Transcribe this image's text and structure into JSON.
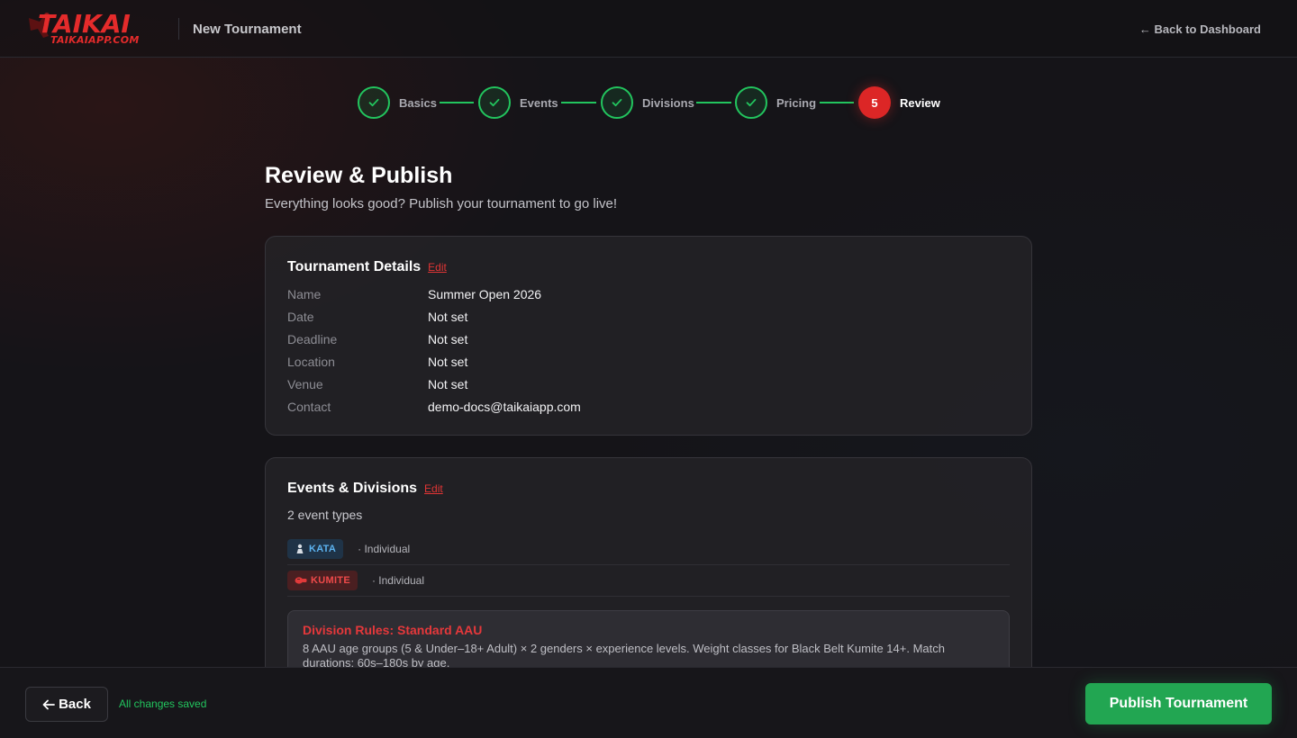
{
  "brand": {
    "name": "TAIKAI",
    "domain": "TAIKAIAPP.COM",
    "accent_color": "#dc2626"
  },
  "header": {
    "title": "New Tournament",
    "back_link": "← Back to Dashboard"
  },
  "stepper": {
    "steps": [
      {
        "label": "Basics",
        "status": "complete"
      },
      {
        "label": "Events",
        "status": "complete"
      },
      {
        "label": "Divisions",
        "status": "complete"
      },
      {
        "label": "Pricing",
        "status": "complete"
      },
      {
        "label": "Review",
        "status": "active",
        "number": "5"
      }
    ],
    "complete_color": "#22c55e"
  },
  "main": {
    "title": "Review & Publish",
    "subtitle": "Everything looks good? Publish your tournament to go live!"
  },
  "tournament_details": {
    "title": "Tournament Details",
    "edit_label": "Edit",
    "rows": [
      {
        "label": "Name",
        "value": "Summer Open 2026"
      },
      {
        "label": "Date",
        "value": "Not set"
      },
      {
        "label": "Deadline",
        "value": "Not set"
      },
      {
        "label": "Location",
        "value": "Not set"
      },
      {
        "label": "Venue",
        "value": "Not set"
      },
      {
        "label": "Contact",
        "value": "demo-docs@taikaiapp.com"
      }
    ]
  },
  "events_divisions": {
    "title": "Events & Divisions",
    "edit_label": "Edit",
    "count": "2 event types",
    "events": [
      {
        "name": "KATA",
        "meta": "· Individual",
        "icon": "kata-figure-icon",
        "color": "#5cb3f0"
      },
      {
        "name": "KUMITE",
        "meta": "· Individual",
        "icon": "kumite-glove-icon",
        "color": "#ef4a4a"
      }
    ],
    "rules": {
      "title": "Division Rules: Standard AAU",
      "text": "8 AAU age groups (5 & Under–18+ Adult) × 2 genders × experience levels. Weight classes for Black Belt Kumite 14+. Match durations: 60s–180s by age."
    }
  },
  "footer": {
    "back_label": "Back",
    "status": "All changes saved",
    "publish_label": "Publish Tournament",
    "publish_color": "#22a652"
  }
}
